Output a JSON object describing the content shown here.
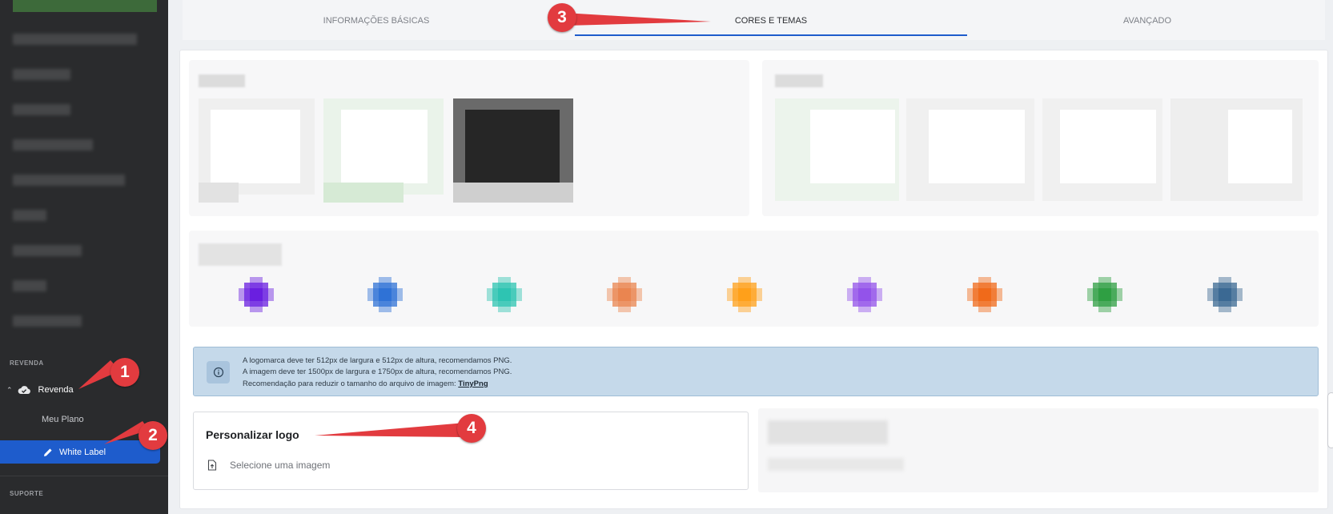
{
  "sidebar": {
    "section_revenda": "REVENDA",
    "revenda_label": "Revenda",
    "meu_plano_label": "Meu Plano",
    "white_label_label": "White Label",
    "section_suporte": "SUPORTE"
  },
  "tabs": {
    "basic": "INFORMAÇÕES BÁSICAS",
    "colors": "CORES E TEMAS",
    "advanced": "AVANÇADO"
  },
  "info": {
    "line1": "A logomarca deve ter 512px de largura e 512px de altura, recomendamos PNG.",
    "line2": "A imagem deve ter 1500px de largura e 1750px de altura, recomendamos PNG.",
    "line3_prefix": "Recomendação para reduzir o tamanho do arquivo de imagem:",
    "line3_link": "TinyPng"
  },
  "logo_card": {
    "title": "Personalizar logo",
    "upload_label": "Selecione uma imagem"
  },
  "callouts": {
    "c1": "1",
    "c2": "2",
    "c3": "3",
    "c4": "4"
  },
  "colors": {
    "accent": "#1e5ccc",
    "sidebar_bg": "#2a2b2d",
    "callout_red": "#e23b3f",
    "swatches": [
      "#6a1fe0",
      "#2f72d6",
      "#2ec4b2",
      "#ea8550",
      "#ffa01a",
      "#9353ea",
      "#f06a1a",
      "#2f9f43",
      "#3b6993"
    ]
  },
  "icons": {
    "revenda": "cloud-icon",
    "white_label": "pencil-icon",
    "info": "info-icon",
    "upload": "file-upload-icon"
  }
}
